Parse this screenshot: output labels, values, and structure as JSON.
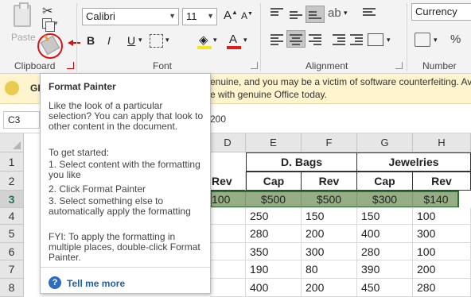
{
  "ribbon": {
    "clipboard": {
      "group_label": "Clipboard",
      "paste_label": "Paste",
      "cut_icon": "scissors-icon",
      "copy_icon": "copy-icon",
      "format_painter_icon": "paintbrush-icon"
    },
    "font": {
      "group_label": "Font",
      "font_name": "Calibri",
      "font_size": "11",
      "increase_label": "A",
      "decrease_label": "A",
      "bold_label": "B",
      "italic_label": "I",
      "underline_label": "U",
      "font_color_label": "A",
      "font_color": "#e01c1c",
      "fill_color": "#f5e61c"
    },
    "alignment": {
      "group_label": "Alignment"
    },
    "number": {
      "group_label": "Number",
      "format": "Currency"
    }
  },
  "infobar": {
    "label": "GE",
    "message_line1": "enuine, and you may be a victim of software counterfeiting. Av",
    "message_line2": "e with genuine Office today."
  },
  "formula_bar": {
    "name_box": "C3",
    "value": "200"
  },
  "grid": {
    "columns": [
      "D",
      "E",
      "F",
      "G",
      "H"
    ],
    "rows": [
      "1",
      "2",
      "3",
      "4",
      "5",
      "6",
      "7",
      "8"
    ],
    "group_headers": [
      "D. Bags",
      "Jewelries"
    ],
    "subheaders": [
      "Rev",
      "Cap",
      "Rev",
      "Cap",
      "Rev"
    ],
    "row3": [
      "100",
      "$500",
      "$500",
      "$300",
      "$140"
    ],
    "data_rows": [
      [
        "250",
        "150",
        "150",
        "100"
      ],
      [
        "280",
        "200",
        "400",
        "300"
      ],
      [
        "350",
        "300",
        "280",
        "100"
      ],
      [
        "190",
        "80",
        "390",
        "200"
      ],
      [
        "400",
        "200",
        "450",
        "280"
      ]
    ]
  },
  "tooltip": {
    "title": "Format Painter",
    "para1": "Like the look of a particular selection? You can apply that look to other content in the document.",
    "intro": "To get started:",
    "step1": "1. Select content with the formatting you like",
    "step2": "2. Click Format Painter",
    "step3": "3. Select something else to automatically apply the formatting",
    "fyi": "FYI: To apply the formatting in multiple places, double-click Format Painter.",
    "help_icon": "question-icon",
    "tell_me_more": "Tell me more"
  }
}
